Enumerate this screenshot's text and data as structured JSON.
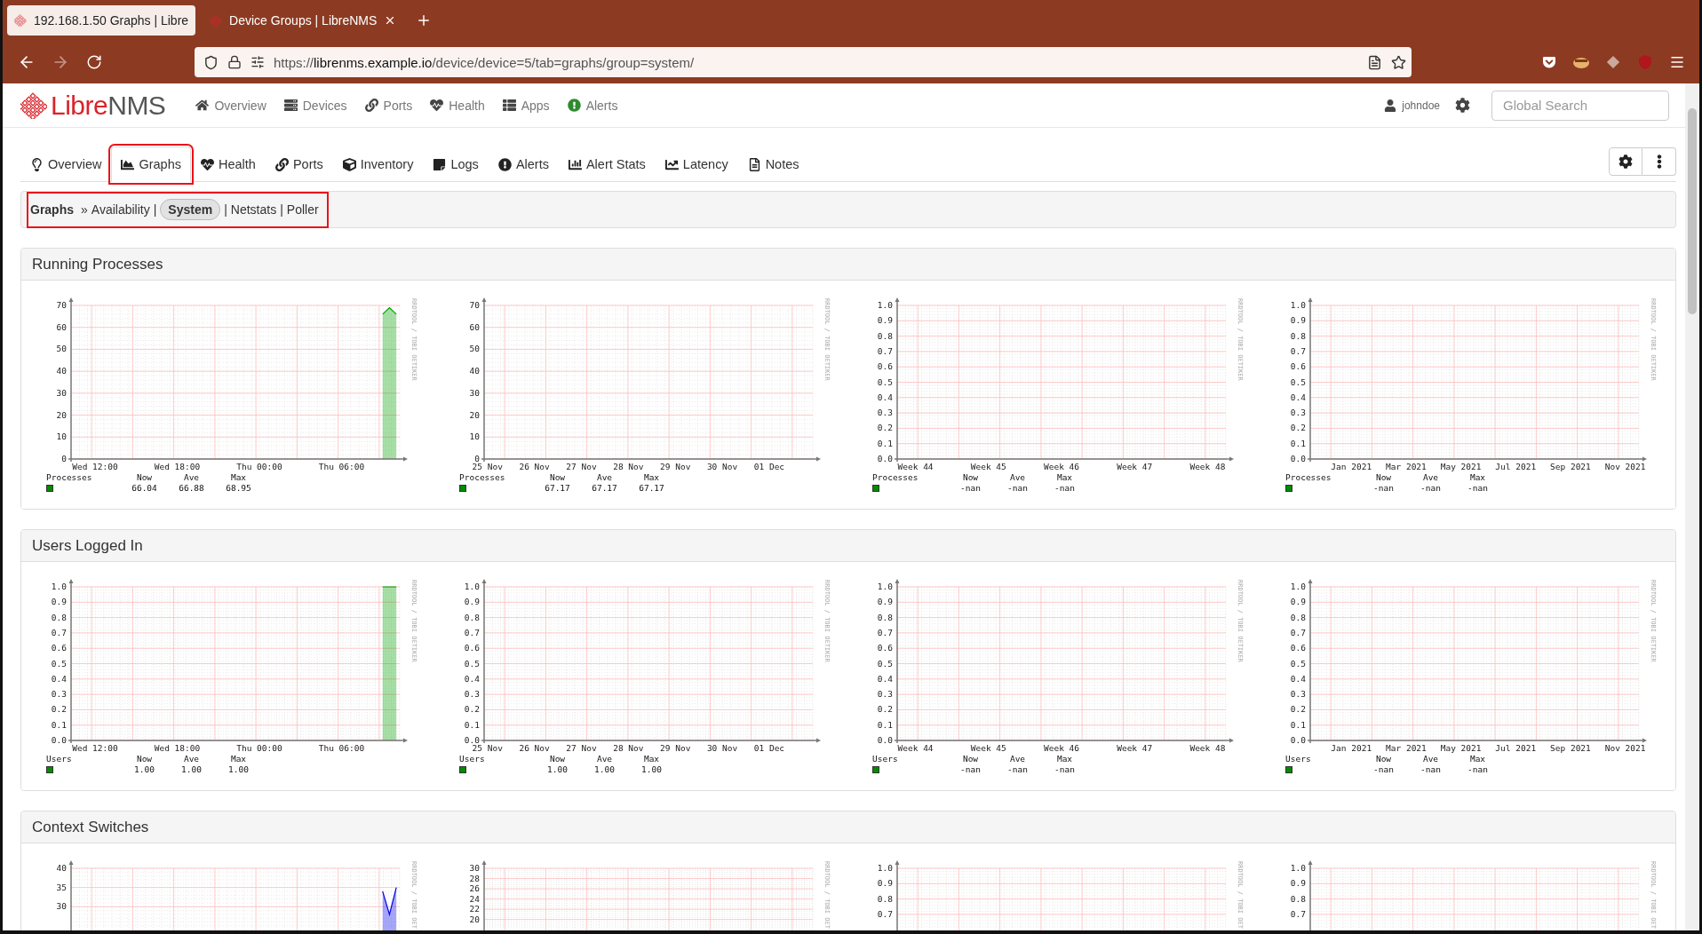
{
  "browser": {
    "tabs": [
      {
        "title": "192.168.1.50 Graphs | Libre",
        "selected": true
      },
      {
        "title": "Device Groups | LibreNMS",
        "selected": false
      }
    ],
    "address": "https://**librenms.example.io**/device/device=5/tab=graphs/group=system/"
  },
  "navbar": {
    "logo": {
      "primary": "Libre",
      "secondary": "NMS"
    },
    "items": [
      "Overview",
      "Devices",
      "Ports",
      "Health",
      "Apps",
      "Alerts"
    ],
    "user": "johndoe",
    "search": {
      "placeholder": "Global Search"
    }
  },
  "device_tabs": [
    {
      "label": "Overview",
      "selected": false,
      "highlighted": false
    },
    {
      "label": "Graphs",
      "selected": true,
      "highlighted": true
    },
    {
      "label": "Health",
      "selected": false,
      "highlighted": false
    },
    {
      "label": "Ports",
      "selected": false,
      "highlighted": false
    },
    {
      "label": "Inventory",
      "selected": false,
      "highlighted": false
    },
    {
      "label": "Logs",
      "selected": false,
      "highlighted": false
    },
    {
      "label": "Alerts",
      "selected": false,
      "highlighted": false
    },
    {
      "label": "Alert Stats",
      "selected": false,
      "highlighted": false
    },
    {
      "label": "Latency",
      "selected": false,
      "highlighted": false
    },
    {
      "label": "Notes",
      "selected": false,
      "highlighted": false
    }
  ],
  "breadcrumb": {
    "highlighted": true,
    "parts": [
      {
        "kind": "title",
        "text": "Graphs"
      },
      {
        "kind": "sep",
        "text": "»"
      },
      {
        "kind": "link",
        "text": "Availability",
        "selected": false
      },
      {
        "kind": "sep",
        "text": "|"
      },
      {
        "kind": "link",
        "text": "System",
        "selected": true
      },
      {
        "kind": "sep",
        "text": "|"
      },
      {
        "kind": "link",
        "text": "Netstats",
        "selected": false
      },
      {
        "kind": "sep",
        "text": "|"
      },
      {
        "kind": "link",
        "text": "Poller",
        "selected": false
      }
    ]
  },
  "sections": [
    {
      "title": "Running Processes",
      "graphs": [
        {
          "chart_data": {
            "type": "area",
            "grid": true,
            "ylim": [
              0,
              70
            ],
            "yticks": [
              0,
              10,
              20,
              30,
              40,
              50,
              60,
              70
            ],
            "categories": [
              null,
              null,
              null,
              "Wed 12:00",
              null,
              null,
              null,
              null,
              null,
              null,
              null,
              null,
              null,
              null,
              null,
              "Wed 18:00",
              null,
              null,
              null,
              null,
              null,
              null,
              null,
              null,
              null,
              null,
              null,
              "Thu 00:00",
              null,
              null,
              null,
              null,
              null,
              null,
              null,
              null,
              null,
              null,
              null,
              "Thu 06:00",
              null,
              null,
              null,
              null,
              null,
              null,
              null,
              null
            ],
            "series": [
              {
                "color": "#00a000",
                "values": [
                  null,
                  null,
                  null,
                  null,
                  null,
                  null,
                  null,
                  null,
                  null,
                  null,
                  null,
                  null,
                  null,
                  null,
                  null,
                  null,
                  null,
                  null,
                  null,
                  null,
                  null,
                  null,
                  null,
                  null,
                  null,
                  null,
                  null,
                  null,
                  null,
                  null,
                  null,
                  null,
                  null,
                  null,
                  null,
                  null,
                  null,
                  null,
                  null,
                  null,
                  null,
                  null,
                  null,
                  null,
                  null,
                  66,
                  69,
                  66
                ]
              }
            ]
          },
          "side_label": "RRDTOOL / TOBI OETIKER",
          "legend": {
            "name": "Processes",
            "color": "#008c00",
            "headings": [
              "Now",
              "Ave",
              "Max"
            ],
            "values": [
              "66.04",
              "66.88",
              "68.95"
            ]
          }
        },
        {
          "chart_data": {
            "type": "area",
            "grid": true,
            "ylim": [
              0,
              70
            ],
            "yticks": [
              0,
              10,
              20,
              30,
              40,
              50,
              60,
              70
            ],
            "categories": [
              "25 Nov",
              null,
              null,
              null,
              null,
              null,
              null,
              "26 Nov",
              null,
              null,
              null,
              null,
              null,
              null,
              "27 Nov",
              null,
              null,
              null,
              null,
              null,
              null,
              "28 Nov",
              null,
              null,
              null,
              null,
              null,
              null,
              "29 Nov",
              null,
              null,
              null,
              null,
              null,
              null,
              "30 Nov",
              null,
              null,
              null,
              null,
              null,
              null,
              "01 Dec",
              null,
              null,
              null,
              null,
              null,
              null
            ]
          },
          "side_label": "RRDTOOL / TOBI OETIKER",
          "legend": {
            "name": "Processes",
            "color": "#008c00",
            "headings": [
              "Now",
              "Ave",
              "Max"
            ],
            "values": [
              "67.17",
              "67.17",
              "67.17"
            ]
          }
        },
        {
          "chart_data": {
            "type": "area",
            "grid": true,
            "ylim": [
              0,
              1
            ],
            "yticks": [
              {
                "value": 0,
                "label": "0.0"
              },
              {
                "value": 0.1,
                "label": "0.1"
              },
              {
                "value": 0.2,
                "label": "0.2"
              },
              {
                "value": 0.3,
                "label": "0.3"
              },
              {
                "value": 0.4,
                "label": "0.4"
              },
              {
                "value": 0.5,
                "label": "0.5"
              },
              {
                "value": 0.6,
                "label": "0.6"
              },
              {
                "value": 0.7,
                "label": "0.7"
              },
              {
                "value": 0.8,
                "label": "0.8"
              },
              {
                "value": 0.9,
                "label": "0.9"
              },
              {
                "value": 1,
                "label": "1.0"
              }
            ],
            "categories": [
              "Week 44",
              null,
              "Week 45",
              null,
              "Week 46",
              null,
              "Week 47",
              null,
              "Week 48"
            ]
          },
          "side_label": "RRDTOOL / TOBI OETIKER",
          "legend": {
            "name": "Processes",
            "color": "#008c00",
            "headings": [
              "Now",
              "Ave",
              "Max"
            ],
            "values": [
              "-nan",
              "-nan",
              "-nan"
            ]
          }
        },
        {
          "chart_data": {
            "type": "area",
            "grid": true,
            "ylim": [
              0,
              1
            ],
            "yticks": [
              {
                "value": 0,
                "label": "0.0"
              },
              {
                "value": 0.1,
                "label": "0.1"
              },
              {
                "value": 0.2,
                "label": "0.2"
              },
              {
                "value": 0.3,
                "label": "0.3"
              },
              {
                "value": 0.4,
                "label": "0.4"
              },
              {
                "value": 0.5,
                "label": "0.5"
              },
              {
                "value": 0.6,
                "label": "0.6"
              },
              {
                "value": 0.7,
                "label": "0.7"
              },
              {
                "value": 0.8,
                "label": "0.8"
              },
              {
                "value": 0.9,
                "label": "0.9"
              },
              {
                "value": 1,
                "label": "1.0"
              }
            ],
            "categories": [
              null,
              "Jan 2021",
              null,
              "Mar 2021",
              null,
              "May 2021",
              null,
              "Jul 2021",
              null,
              "Sep 2021",
              null,
              "Nov 2021"
            ]
          },
          "side_label": "RRDTOOL / TOBI OETIKER",
          "legend": {
            "name": "Processes",
            "color": "#008c00",
            "headings": [
              "Now",
              "Ave",
              "Max"
            ],
            "values": [
              "-nan",
              "-nan",
              "-nan"
            ]
          }
        }
      ]
    },
    {
      "title": "Users Logged In",
      "graphs": [
        {
          "chart_data": {
            "type": "area",
            "grid": true,
            "ylim": [
              0,
              1
            ],
            "yticks": [
              {
                "value": 0,
                "label": "0.0"
              },
              {
                "value": 0.1,
                "label": "0.1"
              },
              {
                "value": 0.2,
                "label": "0.2"
              },
              {
                "value": 0.3,
                "label": "0.3"
              },
              {
                "value": 0.4,
                "label": "0.4"
              },
              {
                "value": 0.5,
                "label": "0.5"
              },
              {
                "value": 0.6,
                "label": "0.6"
              },
              {
                "value": 0.7,
                "label": "0.7"
              },
              {
                "value": 0.8,
                "label": "0.8"
              },
              {
                "value": 0.9,
                "label": "0.9"
              },
              {
                "value": 1,
                "label": "1.0"
              }
            ],
            "categories": [
              null,
              null,
              null,
              "Wed 12:00",
              null,
              null,
              null,
              null,
              null,
              null,
              null,
              null,
              null,
              null,
              null,
              "Wed 18:00",
              null,
              null,
              null,
              null,
              null,
              null,
              null,
              null,
              null,
              null,
              null,
              "Thu 00:00",
              null,
              null,
              null,
              null,
              null,
              null,
              null,
              null,
              null,
              null,
              null,
              "Thu 06:00",
              null,
              null,
              null,
              null,
              null,
              null,
              null,
              null
            ],
            "series": [
              {
                "color": "#00a000",
                "values": [
                  null,
                  null,
                  null,
                  null,
                  null,
                  null,
                  null,
                  null,
                  null,
                  null,
                  null,
                  null,
                  null,
                  null,
                  null,
                  null,
                  null,
                  null,
                  null,
                  null,
                  null,
                  null,
                  null,
                  null,
                  null,
                  null,
                  null,
                  null,
                  null,
                  null,
                  null,
                  null,
                  null,
                  null,
                  null,
                  null,
                  null,
                  null,
                  null,
                  null,
                  null,
                  null,
                  null,
                  null,
                  null,
                  1,
                  1,
                  1
                ]
              }
            ]
          },
          "side_label": "RRDTOOL / TOBI OETIKER",
          "legend": {
            "name": "Users",
            "color": "#008c00",
            "headings": [
              "Now",
              "Ave",
              "Max"
            ],
            "values": [
              "1.00",
              "1.00",
              "1.00"
            ]
          }
        },
        {
          "chart_data": {
            "type": "area",
            "grid": true,
            "ylim": [
              0,
              1
            ],
            "yticks": [
              {
                "value": 0,
                "label": "0.0"
              },
              {
                "value": 0.1,
                "label": "0.1"
              },
              {
                "value": 0.2,
                "label": "0.2"
              },
              {
                "value": 0.3,
                "label": "0.3"
              },
              {
                "value": 0.4,
                "label": "0.4"
              },
              {
                "value": 0.5,
                "label": "0.5"
              },
              {
                "value": 0.6,
                "label": "0.6"
              },
              {
                "value": 0.7,
                "label": "0.7"
              },
              {
                "value": 0.8,
                "label": "0.8"
              },
              {
                "value": 0.9,
                "label": "0.9"
              },
              {
                "value": 1,
                "label": "1.0"
              }
            ],
            "categories": [
              "25 Nov",
              null,
              null,
              null,
              null,
              null,
              null,
              "26 Nov",
              null,
              null,
              null,
              null,
              null,
              null,
              "27 Nov",
              null,
              null,
              null,
              null,
              null,
              null,
              "28 Nov",
              null,
              null,
              null,
              null,
              null,
              null,
              "29 Nov",
              null,
              null,
              null,
              null,
              null,
              null,
              "30 Nov",
              null,
              null,
              null,
              null,
              null,
              null,
              "01 Dec",
              null,
              null,
              null,
              null,
              null,
              null
            ]
          },
          "side_label": "RRDTOOL / TOBI OETIKER",
          "legend": {
            "name": "Users",
            "color": "#008c00",
            "headings": [
              "Now",
              "Ave",
              "Max"
            ],
            "values": [
              "1.00",
              "1.00",
              "1.00"
            ]
          }
        },
        {
          "chart_data": {
            "type": "area",
            "grid": true,
            "ylim": [
              0,
              1
            ],
            "yticks": [
              {
                "value": 0,
                "label": "0.0"
              },
              {
                "value": 0.1,
                "label": "0.1"
              },
              {
                "value": 0.2,
                "label": "0.2"
              },
              {
                "value": 0.3,
                "label": "0.3"
              },
              {
                "value": 0.4,
                "label": "0.4"
              },
              {
                "value": 0.5,
                "label": "0.5"
              },
              {
                "value": 0.6,
                "label": "0.6"
              },
              {
                "value": 0.7,
                "label": "0.7"
              },
              {
                "value": 0.8,
                "label": "0.8"
              },
              {
                "value": 0.9,
                "label": "0.9"
              },
              {
                "value": 1,
                "label": "1.0"
              }
            ],
            "categories": [
              "Week 44",
              null,
              "Week 45",
              null,
              "Week 46",
              null,
              "Week 47",
              null,
              "Week 48"
            ]
          },
          "side_label": "RRDTOOL / TOBI OETIKER",
          "legend": {
            "name": "Users",
            "color": "#008c00",
            "headings": [
              "Now",
              "Ave",
              "Max"
            ],
            "values": [
              "-nan",
              "-nan",
              "-nan"
            ]
          }
        },
        {
          "chart_data": {
            "type": "area",
            "grid": true,
            "ylim": [
              0,
              1
            ],
            "yticks": [
              {
                "value": 0,
                "label": "0.0"
              },
              {
                "value": 0.1,
                "label": "0.1"
              },
              {
                "value": 0.2,
                "label": "0.2"
              },
              {
                "value": 0.3,
                "label": "0.3"
              },
              {
                "value": 0.4,
                "label": "0.4"
              },
              {
                "value": 0.5,
                "label": "0.5"
              },
              {
                "value": 0.6,
                "label": "0.6"
              },
              {
                "value": 0.7,
                "label": "0.7"
              },
              {
                "value": 0.8,
                "label": "0.8"
              },
              {
                "value": 0.9,
                "label": "0.9"
              },
              {
                "value": 1,
                "label": "1.0"
              }
            ],
            "categories": [
              null,
              "Jan 2021",
              null,
              "Mar 2021",
              null,
              "May 2021",
              null,
              "Jul 2021",
              null,
              "Sep 2021",
              null,
              "Nov 2021"
            ]
          },
          "side_label": "RRDTOOL / TOBI OETIKER",
          "legend": {
            "name": "Users",
            "color": "#008c00",
            "headings": [
              "Now",
              "Ave",
              "Max"
            ],
            "values": [
              "-nan",
              "-nan",
              "-nan"
            ]
          }
        }
      ]
    },
    {
      "title": "Context Switches",
      "graphs": [
        {
          "chart_data": {
            "type": "area",
            "grid": true,
            "ylim": [
              0,
              40
            ],
            "yticks": [
              30,
              35,
              40
            ],
            "categories": [
              null,
              null,
              null,
              null,
              null,
              null,
              null,
              null,
              null,
              null,
              null,
              null,
              null,
              null,
              null,
              null,
              null,
              null,
              null,
              null,
              null,
              null,
              null,
              null,
              null,
              null,
              null,
              null,
              null,
              null,
              null,
              null,
              null,
              null,
              null,
              null,
              null,
              null,
              null,
              null,
              null,
              null,
              null,
              null,
              null,
              null,
              null,
              null
            ],
            "series": [
              {
                "color": "#0000ee",
                "values": [
                  null,
                  null,
                  null,
                  null,
                  null,
                  null,
                  null,
                  null,
                  null,
                  null,
                  null,
                  null,
                  null,
                  null,
                  null,
                  null,
                  null,
                  null,
                  null,
                  null,
                  null,
                  null,
                  null,
                  null,
                  null,
                  null,
                  null,
                  null,
                  null,
                  null,
                  null,
                  null,
                  null,
                  null,
                  null,
                  null,
                  null,
                  null,
                  null,
                  null,
                  null,
                  null,
                  null,
                  null,
                  null,
                  34,
                  28,
                  35
                ]
              }
            ]
          },
          "side_label": "RRDTOOL / TOBI OET"
        },
        {
          "chart_data": {
            "type": "area",
            "grid": true,
            "ylim": [
              0,
              30
            ],
            "yticks": [
              20,
              22,
              24,
              26,
              28,
              30
            ],
            "categories": [
              null,
              null,
              null,
              null,
              null,
              null,
              null,
              null,
              null
            ]
          },
          "side_label": "RRDTOOL / TOBI OET"
        },
        {
          "chart_data": {
            "type": "area",
            "grid": true,
            "ylim": [
              0,
              1
            ],
            "yticks": [
              {
                "value": 0.7,
                "label": "0.7"
              },
              {
                "value": 0.8,
                "label": "0.8"
              },
              {
                "value": 0.9,
                "label": "0.9"
              },
              {
                "value": 1,
                "label": "1.0"
              }
            ],
            "categories": [
              null,
              null,
              null,
              null,
              null,
              null,
              null,
              null,
              null
            ]
          },
          "side_label": "RRDTOOL / TOBI OET"
        },
        {
          "chart_data": {
            "type": "area",
            "categories": [
              null,
              null,
              null,
              null,
              null,
              null,
              null,
              null,
              null
            ],
            "grid": true,
            "ylim": [
              0,
              1
            ],
            "yticks": [
              {
                "value": 0.7,
                "label": "0.7"
              },
              {
                "value": 0.8,
                "label": "0.8"
              },
              {
                "value": 0.9,
                "label": "0.9"
              },
              {
                "value": 1,
                "label": "1.0"
              }
            ]
          },
          "side_label": "RRDTOOL / TOBI OET"
        }
      ]
    }
  ]
}
